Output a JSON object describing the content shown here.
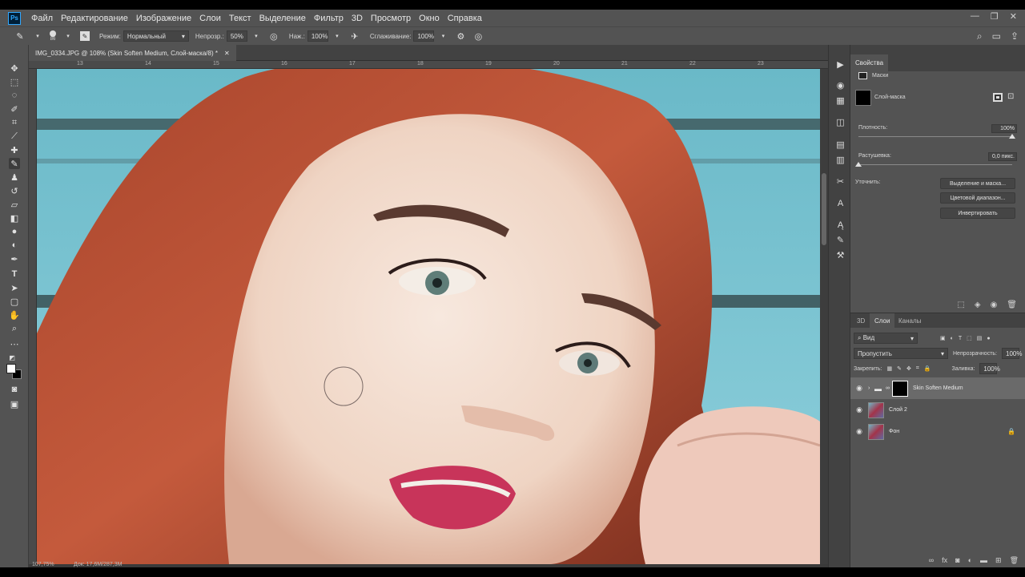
{
  "app": {
    "logo": "Ps"
  },
  "menu": [
    "Файл",
    "Редактирование",
    "Изображение",
    "Слои",
    "Текст",
    "Выделение",
    "Фильтр",
    "3D",
    "Просмотр",
    "Окно",
    "Справка"
  ],
  "options": {
    "brush_size": "86",
    "mode_label": "Режим:",
    "mode_value": "Нормальный",
    "opacity_label": "Непрозр.:",
    "opacity_value": "50%",
    "flow_label": "Наж.:",
    "flow_value": "100%",
    "smoothing_label": "Сглаживание:",
    "smoothing_value": "100%"
  },
  "document": {
    "tab_title": "IMG_0334.JPG @ 108% (Skin Soften Medium, Слой-маска/8) *",
    "ruler_labels": [
      "13",
      "14",
      "15",
      "16",
      "17",
      "18",
      "19",
      "20",
      "21",
      "22",
      "23"
    ],
    "status_zoom": "107,75%",
    "status_doc": "Док: 17,6M/287,3M"
  },
  "properties": {
    "tabs": [
      "Свойства"
    ],
    "section": "Маски",
    "mask_name": "Слой-маска",
    "density_label": "Плотность:",
    "density_value": "100%",
    "feather_label": "Растушевка:",
    "feather_value": "0,0 пикс.",
    "refine_label": "Уточнить:",
    "btn_select_mask": "Выделение и маска...",
    "btn_color_range": "Цветовой диапазон...",
    "btn_invert": "Инвертировать"
  },
  "layers": {
    "tabs": [
      "3D",
      "Слои",
      "Каналы"
    ],
    "filter_kind": "Вид",
    "blend_mode": "Пропустить",
    "opacity_label": "Непрозрачность:",
    "opacity_value": "100%",
    "lock_label": "Закрепить:",
    "fill_label": "Заливка:",
    "fill_value": "100%",
    "items": [
      {
        "name": "Skin Soften Medium"
      },
      {
        "name": "Слой 2"
      },
      {
        "name": "Фон"
      }
    ]
  }
}
